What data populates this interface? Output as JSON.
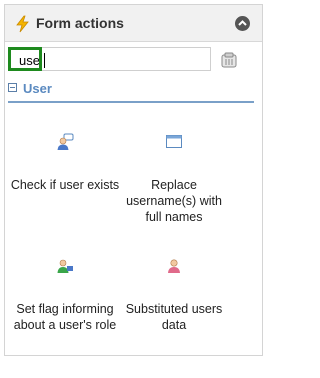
{
  "header": {
    "title": "Form actions"
  },
  "search": {
    "value": "use"
  },
  "group": {
    "label": "User"
  },
  "actions": [
    {
      "label": "Check if user exists",
      "icon": "user-chat-icon"
    },
    {
      "label": "Replace username(s) with full names",
      "icon": "window-icon"
    },
    {
      "label": "Set flag informing about a user's role",
      "icon": "user-flag-icon"
    },
    {
      "label": "Substituted users data",
      "icon": "user-icon"
    }
  ]
}
